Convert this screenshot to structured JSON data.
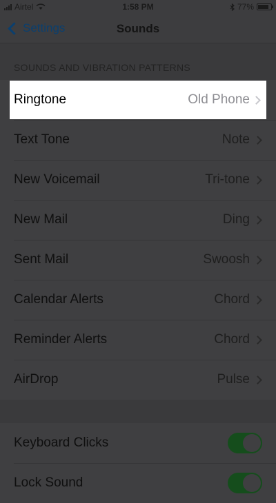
{
  "status_bar": {
    "carrier": "Airtel",
    "time": "1:58 PM",
    "battery_percent": "77%",
    "battery_level": 0.77
  },
  "nav": {
    "back_label": "Settings",
    "title": "Sounds"
  },
  "section": {
    "header": "SOUNDS AND VIBRATION PATTERNS"
  },
  "rows": [
    {
      "label": "Ringtone",
      "value": "Old Phone"
    },
    {
      "label": "Text Tone",
      "value": "Note"
    },
    {
      "label": "New Voicemail",
      "value": "Tri-tone"
    },
    {
      "label": "New Mail",
      "value": "Ding"
    },
    {
      "label": "Sent Mail",
      "value": "Swoosh"
    },
    {
      "label": "Calendar Alerts",
      "value": "Chord"
    },
    {
      "label": "Reminder Alerts",
      "value": "Chord"
    },
    {
      "label": "AirDrop",
      "value": "Pulse"
    }
  ],
  "toggles": [
    {
      "label": "Keyboard Clicks",
      "on": true
    },
    {
      "label": "Lock Sound",
      "on": true
    }
  ],
  "colors": {
    "accent": "#007aff",
    "toggle_on": "#4cd964"
  }
}
